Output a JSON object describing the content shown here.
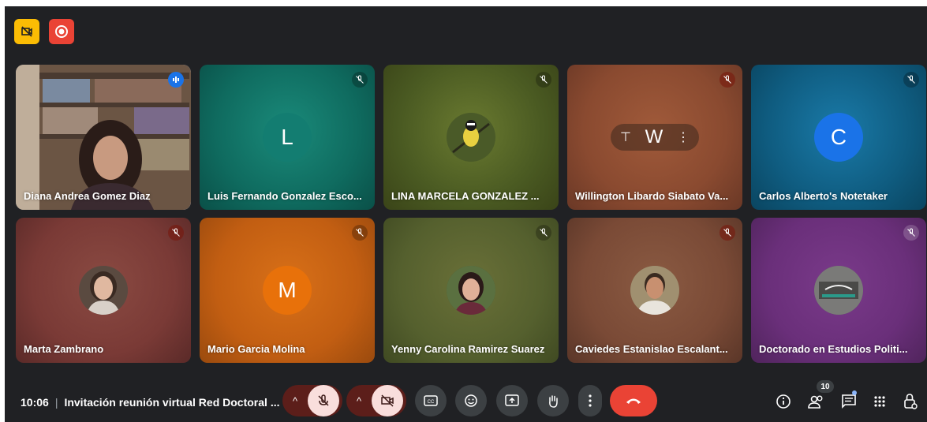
{
  "colors": {
    "window_bg": "#202124",
    "tile_highlight": "#aecbfa",
    "end_call": "#ea4335",
    "muted_button": "#f9dedc"
  },
  "top_icons": [
    "camera-off-icon",
    "record-icon"
  ],
  "participants": [
    {
      "name": "Diana Andrea Gomez Diaz",
      "kind": "video",
      "mic": "speaking",
      "bg": "#6a5040"
    },
    {
      "name": "Luis Fernando Gonzalez Esco...",
      "kind": "letter",
      "initial": "L",
      "avatar_bg": "#137d71",
      "mic": "muted",
      "bg": "#0f6b5f"
    },
    {
      "name": "LINA MARCELA GONZALEZ ...",
      "kind": "photo",
      "avatar": "bird",
      "mic": "muted",
      "bg": "#4a5a22"
    },
    {
      "name": "Willington Libardo Siabato Va...",
      "kind": "hover",
      "initial": "W",
      "mic": "muted-red",
      "bg": "#8a4a30"
    },
    {
      "name": "Carlos Alberto's Notetaker",
      "kind": "letter",
      "initial": "C",
      "avatar_bg": "#1a73e8",
      "mic": "muted",
      "bg": "#0f5c80"
    },
    {
      "name": "Marta Zambrano",
      "kind": "photo",
      "avatar": "woman",
      "mic": "muted-red",
      "bg": "#7a3a36"
    },
    {
      "name": "Mario Garcia Molina",
      "kind": "letter",
      "initial": "M",
      "avatar_bg": "#e8710a",
      "mic": "muted",
      "bg": "#c25e12"
    },
    {
      "name": "Yenny Carolina Ramirez Suarez",
      "kind": "photo",
      "avatar": "woman2",
      "mic": "muted",
      "bg": "#55602e"
    },
    {
      "name": "Caviedes Estanislao Escalant...",
      "kind": "photo",
      "avatar": "man",
      "mic": "muted-red",
      "bg": "#7a4a36"
    },
    {
      "name": "Doctorado en Estudios Politi...",
      "kind": "photo",
      "avatar": "logo",
      "mic": "muted",
      "bg": "#6a2f7a"
    }
  ],
  "bottom_bar": {
    "time": "10:06",
    "meeting_title": "Invitación reunión virtual Red Doctoral ...",
    "controls": [
      "mic-off-icon",
      "camera-off-icon",
      "captions-icon",
      "emoji-icon",
      "present-icon",
      "raise-hand-icon",
      "more-options-icon",
      "end-call-icon"
    ],
    "right_icons": [
      "info-icon",
      "people-icon",
      "chat-icon",
      "activities-icon",
      "host-controls-icon"
    ],
    "people_count": "10"
  }
}
